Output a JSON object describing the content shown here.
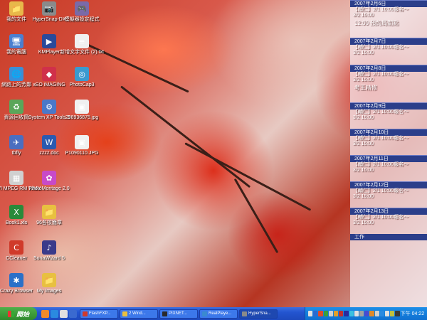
{
  "desktop_icons": [
    {
      "name": "my-documents-icon",
      "label": "我的文件",
      "color": "#e8b84a",
      "glyph": "📁"
    },
    {
      "name": "my-computer-icon",
      "label": "我的電腦",
      "color": "#4a7fd0",
      "glyph": "🖥"
    },
    {
      "name": "network-places-icon",
      "label": "網路上的芳鄰",
      "color": "#3a8fd8",
      "glyph": "🌐"
    },
    {
      "name": "recycle-bin-icon",
      "label": "資源回收筒",
      "color": "#5aa65a",
      "glyph": "♻"
    },
    {
      "name": "tbfly-icon",
      "label": "tbfly",
      "color": "#4a6ec0",
      "glyph": "✈"
    },
    {
      "name": "avi-mpeg-rm-wmv-icon",
      "label": "AVI MPEG RM WMV",
      "color": "#d0d0d0",
      "glyph": "▦"
    },
    {
      "name": "book1-xls-icon",
      "label": "Book1.xls",
      "color": "#2a8a3a",
      "glyph": "X"
    },
    {
      "name": "ccleaner-icon",
      "label": "CCleaner",
      "color": "#d03a2a",
      "glyph": "C"
    },
    {
      "name": "crazy-browser-icon",
      "label": "Crazy Browser",
      "color": "#2a70c8",
      "glyph": "✱"
    },
    {
      "name": "hypersnap-dx-icon",
      "label": "HyperSnap-DX",
      "color": "#8a8a8a",
      "glyph": "📷"
    },
    {
      "name": "kmplayer-icon",
      "label": "KMPlayer",
      "color": "#2a4a9a",
      "glyph": "▶"
    },
    {
      "name": "xeo-imaging-icon",
      "label": "xEO iMAGING",
      "color": "#d0304a",
      "glyph": "◆"
    },
    {
      "name": "system-xp-tools-icon",
      "label": "System XP Tools 3",
      "color": "#4a78c8",
      "glyph": "⚙"
    },
    {
      "name": "zzz-doc-icon",
      "label": "zzzz.doc",
      "color": "#2a5ab0",
      "glyph": "W"
    },
    {
      "name": "photomontage-icon",
      "label": "PhotoMontage 2.0",
      "color": "#c84ac8",
      "glyph": "✿"
    },
    {
      "name": "96-folder-icon",
      "label": "96各校簡章",
      "color": "#e8c040",
      "glyph": "📁"
    },
    {
      "name": "sonawizard-icon",
      "label": "SonaWizard 5",
      "color": "#3a3a8a",
      "glyph": "♪"
    },
    {
      "name": "my-images-icon",
      "label": "My Images",
      "color": "#e8c040",
      "glyph": "📁"
    },
    {
      "name": "simulator-settings-icon",
      "label": "模擬器設定程式",
      "color": "#7a6aa8",
      "glyph": "🎮"
    },
    {
      "name": "new-text-file-icon",
      "label": "新增文字文件 (2).txt",
      "color": "#f0f0f0",
      "glyph": "≡"
    },
    {
      "name": "photocap-icon",
      "label": "PhotoCap3",
      "color": "#3a9ad0",
      "glyph": "◎"
    },
    {
      "name": "jpg-file-icon",
      "label": "298936875.jpg",
      "color": "#f0f0f0",
      "glyph": "▣"
    },
    {
      "name": "p1090110-jpg-icon",
      "label": "P1090110.JPG",
      "color": "#f0f0f0",
      "glyph": "▣"
    }
  ],
  "calendar": [
    {
      "date": "2007年2月6日",
      "lines": [
        "【輔仁】2/1 10:00報名～",
        "3/2 15:00"
      ],
      "big": "12:00 預約局關點"
    },
    {
      "date": "2007年2月7日",
      "lines": [
        "【輔仁】2/1 10:00報名～",
        "3/2 15:00"
      ],
      "big": ""
    },
    {
      "date": "2007年2月8日",
      "lines": [
        "【輔仁】2/1 10:00報名～",
        "3/2 15:00"
      ],
      "big": "考王精修"
    },
    {
      "date": "2007年2月9日",
      "lines": [
        "【輔仁】2/1 10:00報名～",
        "3/2 15:00"
      ],
      "big": ""
    },
    {
      "date": "2007年2月10日",
      "lines": [
        "【輔仁】2/1 10:00報名～",
        "3/2 15:00"
      ],
      "big": ""
    },
    {
      "date": "2007年2月11日",
      "lines": [
        "【輔仁】2/1 10:00報名～",
        "3/2 15:00"
      ],
      "big": ""
    },
    {
      "date": "2007年2月12日",
      "lines": [
        "【輔仁】2/1 10:00報名～",
        "3/2 15:00"
      ],
      "big": ""
    },
    {
      "date": "2007年2月13日",
      "lines": [
        "【輔仁】2/1 10:00報名～",
        "3/2 15:00"
      ],
      "big": ""
    }
  ],
  "calendar_footer": "工作",
  "taskbar": {
    "start_label": "開始",
    "quick_launch": [
      "#f08a2a",
      "#2a8ae0",
      "#e0e0e0",
      "#3a6ad0"
    ],
    "tasks": [
      {
        "label": "FlashFXP...",
        "color": "#d03a2a"
      },
      {
        "label": "2 Wind...",
        "color": "#e8c040"
      },
      {
        "label": "PIXNET...",
        "color": "#2a2a2a"
      },
      {
        "label": "RealPlaye...",
        "color": "#3a8ad0"
      },
      {
        "label": "HyperSna...",
        "color": "#8a8a8a"
      }
    ],
    "tray_colors": [
      "#e0e0e0",
      "#2a6ad0",
      "#e04a2a",
      "#3aa03a",
      "#d0d0d0",
      "#e0a02a",
      "#c03030",
      "#2a2aa0",
      "#3ac0e0",
      "#e0e0e0",
      "#a0a0a0",
      "#4a4ad0",
      "#e08a2a",
      "#d0d0d0",
      "#2a8ae0",
      "#e0e0e0",
      "#c0c040",
      "#3a3a3a"
    ],
    "clock": "下午 04:22"
  }
}
